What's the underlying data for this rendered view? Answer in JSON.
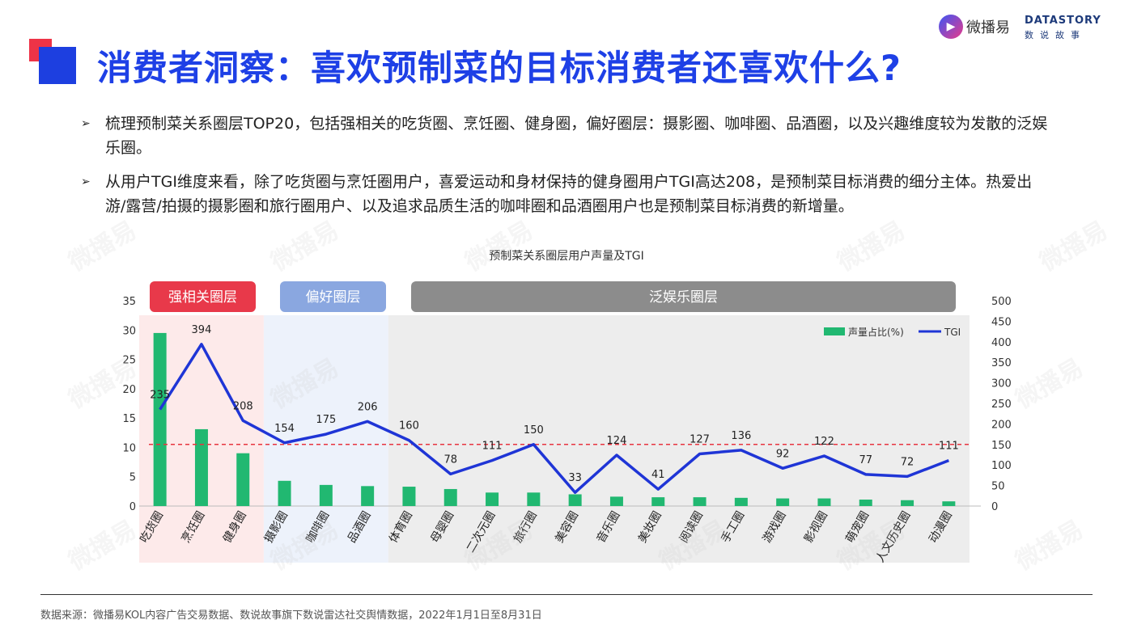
{
  "header": {
    "title": "消费者洞察：喜欢预制菜的目标消费者还喜欢什么?",
    "logo_wbj": "微播易",
    "logo_ds_en": "DATASTORY",
    "logo_ds_cn": "数说故事"
  },
  "bullets": [
    "梳理预制菜关系圈层TOP20，包括强相关的吃货圈、烹饪圈、健身圈，偏好圈层：摄影圈、咖啡圈、品酒圈，以及兴趣维度较为发散的泛娱乐圈。",
    "从用户TGI维度来看，除了吃货圈与烹饪圈用户，喜爱运动和身材保持的健身圈用户TGI高达208，是预制菜目标消费的细分主体。热爱出游/露营/拍摄的摄影圈和旅行圈用户、以及追求品质生活的咖啡圈和品酒圈用户也是预制菜目标消费的新增量。"
  ],
  "bullet_marker": "➢",
  "watermark_text": "微播易",
  "footer": {
    "source": "数据来源：微播易KOL内容广告交易数据、数说故事旗下数说雷达社交舆情数据，2022年1月1日至8月31日"
  },
  "colors": {
    "title": "#1e40e6",
    "bar": "#21b871",
    "line": "#1f35d6",
    "ref_line": "#e8343f",
    "group_strong": "#e8394a",
    "group_pref": "#8aa7e0",
    "group_pan": "#8c8c8c",
    "band_strong": "#fdeaea",
    "band_pref": "#edf2fb",
    "band_pan": "#ededed"
  },
  "chart_data": {
    "type": "bar+line",
    "title": "预制菜关系圈层用户声量及TGI",
    "categories": [
      "吃货圈",
      "烹饪圈",
      "健身圈",
      "摄影圈",
      "咖啡圈",
      "品酒圈",
      "体育圈",
      "母婴圈",
      "二次元圈",
      "旅行圈",
      "美容圈",
      "音乐圈",
      "美妆圈",
      "阅读圈",
      "手工圈",
      "游戏圈",
      "影视圈",
      "萌宠圈",
      "人文历史圈",
      "动漫圈"
    ],
    "series": [
      {
        "name": "声量占比(%)",
        "type": "bar",
        "axis": "left",
        "values": [
          29.5,
          13.1,
          9.0,
          4.3,
          3.6,
          3.4,
          3.3,
          2.9,
          2.3,
          2.3,
          2.0,
          1.6,
          1.5,
          1.5,
          1.4,
          1.3,
          1.3,
          1.1,
          1.0,
          0.8
        ]
      },
      {
        "name": "TGI",
        "type": "line",
        "axis": "right",
        "values": [
          235,
          394,
          208,
          154,
          175,
          206,
          160,
          78,
          111,
          150,
          33,
          124,
          41,
          127,
          136,
          92,
          122,
          77,
          72,
          111
        ]
      }
    ],
    "reference_line": {
      "axis": "right",
      "value": 150,
      "style": "dashed"
    },
    "y_left": {
      "range": [
        0,
        35
      ],
      "ticks": [
        "0",
        "5",
        "10",
        "15",
        "20",
        "25",
        "30",
        "35"
      ]
    },
    "y_right": {
      "range": [
        0,
        500
      ],
      "ticks": [
        "0",
        "50",
        "100",
        "150",
        "200",
        "250",
        "300",
        "350",
        "400",
        "450",
        "500"
      ]
    },
    "groups": [
      {
        "label": "强相关圈层",
        "start": 0,
        "end": 2
      },
      {
        "label": "偏好圈层",
        "start": 3,
        "end": 5
      },
      {
        "label": "泛娱乐圈层",
        "start": 6,
        "end": 19
      }
    ],
    "legend_position": "top-right",
    "grid": false
  }
}
